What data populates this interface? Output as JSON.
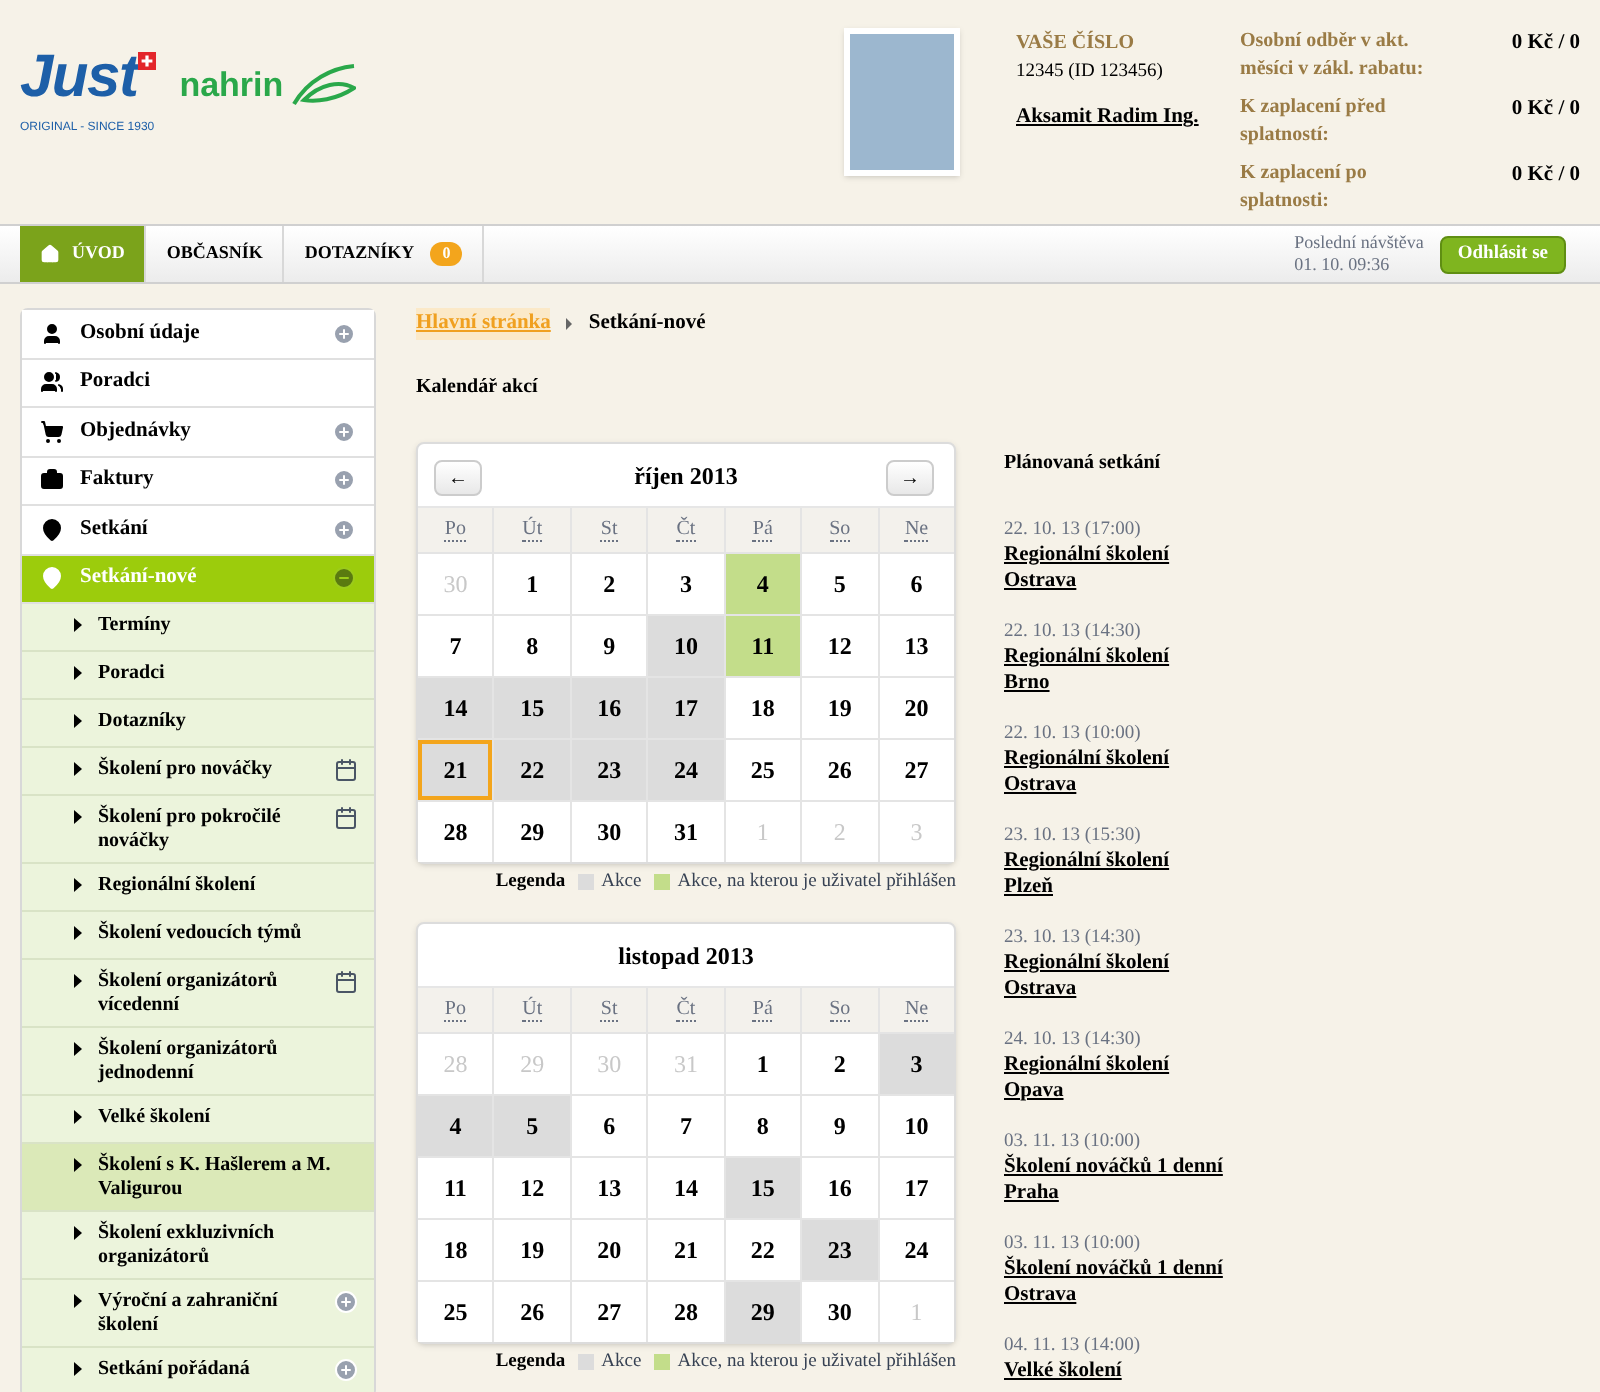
{
  "header": {
    "logo": {
      "brand": "Just",
      "tagline": "ORIGINAL - SINCE 1930",
      "partner": "nahrin"
    },
    "account": {
      "label": "VAŠE ČÍSLO",
      "number": "12345 (ID 123456)",
      "name": "Aksamit Radim Ing."
    },
    "balances": [
      {
        "label": "Osobní odběr v akt. měsíci v zákl. rabatu:",
        "value": "0 Kč / 0"
      },
      {
        "label": "K zaplacení před splatností:",
        "value": "0 Kč / 0"
      },
      {
        "label": "K zaplacení po splatnosti:",
        "value": "0 Kč / 0"
      }
    ]
  },
  "nav": {
    "tabs": [
      {
        "label": "ÚVOD",
        "selected": true
      },
      {
        "label": "OBČASNÍK",
        "selected": false
      },
      {
        "label": "DOTAZNÍKY",
        "selected": false,
        "badge": "0"
      }
    ],
    "last_visit_label": "Poslední návštěva",
    "last_visit": "01. 10. 09:36",
    "logout": "Odhlásit se"
  },
  "sidebar": {
    "items": [
      {
        "label": "Osobní údaje",
        "kind": "person",
        "collapsible": true,
        "expanded": false,
        "selected": false
      },
      {
        "label": "Poradci",
        "kind": "people",
        "collapsible": false,
        "selected": false
      },
      {
        "label": "Objednávky",
        "kind": "cart",
        "collapsible": true,
        "expanded": false,
        "selected": false
      },
      {
        "label": "Faktury",
        "kind": "briefcase",
        "collapsible": true,
        "expanded": false,
        "selected": false
      },
      {
        "label": "Setkání",
        "kind": "pin",
        "collapsible": true,
        "expanded": false,
        "selected": false
      },
      {
        "label": "Setkání-nové",
        "kind": "pin",
        "collapsible": true,
        "expanded": true,
        "selected": true,
        "children": [
          {
            "label": "Termíny",
            "calendar": false,
            "collapsible": false,
            "selected": false
          },
          {
            "label": "Poradci",
            "calendar": false,
            "collapsible": false,
            "selected": false
          },
          {
            "label": "Dotazníky",
            "calendar": false,
            "collapsible": false,
            "selected": false
          },
          {
            "label": "Školení pro nováčky",
            "calendar": true,
            "collapsible": false,
            "selected": false
          },
          {
            "label": "Školení pro pokročilé nováčky",
            "calendar": true,
            "collapsible": false,
            "selected": false
          },
          {
            "label": "Regionální školení",
            "calendar": false,
            "collapsible": false,
            "selected": false
          },
          {
            "label": "Školení vedoucích týmů",
            "calendar": false,
            "collapsible": false,
            "selected": false
          },
          {
            "label": "Školení organizátorů vícedenní",
            "calendar": true,
            "collapsible": false,
            "selected": false
          },
          {
            "label": "Školení organizátorů jednodenní",
            "calendar": false,
            "collapsible": false,
            "selected": false
          },
          {
            "label": "Velké školení",
            "calendar": false,
            "collapsible": false,
            "selected": false
          },
          {
            "label": "Školení s K. Hašlerem a M. Valigurou",
            "calendar": false,
            "collapsible": false,
            "selected": true
          },
          {
            "label": "Školení exkluzivních organizátorů",
            "calendar": false,
            "collapsible": false,
            "selected": false
          },
          {
            "label": "Výroční a zahraniční školení",
            "calendar": false,
            "collapsible": true,
            "expanded": false,
            "selected": false
          },
          {
            "label": "Setkání pořádaná",
            "calendar": false,
            "collapsible": true,
            "expanded": false,
            "selected": false
          }
        ]
      }
    ]
  },
  "breadcrumb": [
    {
      "label": "Hlavní stránka",
      "kind": "link"
    },
    {
      "label": "Setkání-nové",
      "kind": "current"
    }
  ],
  "calendar_title": "Kalendář akcí",
  "calendars": [
    {
      "title": "říjen 2013",
      "prev": "←",
      "next": "→",
      "weekdays": [
        "Po",
        "Út",
        "St",
        "Čt",
        "Pá",
        "So",
        "Ne"
      ],
      "weeks": [
        [
          {
            "day": "30",
            "kind": "outside"
          },
          {
            "day": "1",
            "kind": "plain"
          },
          {
            "day": "2",
            "kind": "plain"
          },
          {
            "day": "3",
            "kind": "plain"
          },
          {
            "day": "4",
            "kind": "joined"
          },
          {
            "day": "5",
            "kind": "plain"
          },
          {
            "day": "6",
            "kind": "plain"
          }
        ],
        [
          {
            "day": "7",
            "kind": "plain"
          },
          {
            "day": "8",
            "kind": "plain"
          },
          {
            "day": "9",
            "kind": "plain"
          },
          {
            "day": "10",
            "kind": "event"
          },
          {
            "day": "11",
            "kind": "joined"
          },
          {
            "day": "12",
            "kind": "plain"
          },
          {
            "day": "13",
            "kind": "plain"
          }
        ],
        [
          {
            "day": "14",
            "kind": "event"
          },
          {
            "day": "15",
            "kind": "event"
          },
          {
            "day": "16",
            "kind": "event"
          },
          {
            "day": "17",
            "kind": "event"
          },
          {
            "day": "18",
            "kind": "plain"
          },
          {
            "day": "19",
            "kind": "plain"
          },
          {
            "day": "20",
            "kind": "plain"
          }
        ],
        [
          {
            "day": "21",
            "kind": "event_today"
          },
          {
            "day": "22",
            "kind": "event"
          },
          {
            "day": "23",
            "kind": "event"
          },
          {
            "day": "24",
            "kind": "event"
          },
          {
            "day": "25",
            "kind": "plain"
          },
          {
            "day": "26",
            "kind": "plain"
          },
          {
            "day": "27",
            "kind": "plain"
          }
        ],
        [
          {
            "day": "28",
            "kind": "plain"
          },
          {
            "day": "29",
            "kind": "plain"
          },
          {
            "day": "30",
            "kind": "plain"
          },
          {
            "day": "31",
            "kind": "plain"
          },
          {
            "day": "1",
            "kind": "outside"
          },
          {
            "day": "2",
            "kind": "outside"
          },
          {
            "day": "3",
            "kind": "outside"
          }
        ]
      ],
      "legend_title": "Legenda",
      "legend": [
        {
          "label": "Akce",
          "color": "#dcdcdc"
        },
        {
          "label": "Akce, na kterou je uživatel přihlášen",
          "color": "#c3dd8a"
        }
      ]
    },
    {
      "title": "listopad 2013",
      "weekdays": [
        "Po",
        "Út",
        "St",
        "Čt",
        "Pá",
        "So",
        "Ne"
      ],
      "weeks": [
        [
          {
            "day": "28",
            "kind": "outside"
          },
          {
            "day": "29",
            "kind": "outside"
          },
          {
            "day": "30",
            "kind": "outside"
          },
          {
            "day": "31",
            "kind": "outside"
          },
          {
            "day": "1",
            "kind": "plain"
          },
          {
            "day": "2",
            "kind": "plain"
          },
          {
            "day": "3",
            "kind": "event"
          }
        ],
        [
          {
            "day": "4",
            "kind": "event"
          },
          {
            "day": "5",
            "kind": "event"
          },
          {
            "day": "6",
            "kind": "plain"
          },
          {
            "day": "7",
            "kind": "plain"
          },
          {
            "day": "8",
            "kind": "plain"
          },
          {
            "day": "9",
            "kind": "plain"
          },
          {
            "day": "10",
            "kind": "plain"
          }
        ],
        [
          {
            "day": "11",
            "kind": "plain"
          },
          {
            "day": "12",
            "kind": "plain"
          },
          {
            "day": "13",
            "kind": "plain"
          },
          {
            "day": "14",
            "kind": "plain"
          },
          {
            "day": "15",
            "kind": "event"
          },
          {
            "day": "16",
            "kind": "plain"
          },
          {
            "day": "17",
            "kind": "plain"
          }
        ],
        [
          {
            "day": "18",
            "kind": "plain"
          },
          {
            "day": "19",
            "kind": "plain"
          },
          {
            "day": "20",
            "kind": "plain"
          },
          {
            "day": "21",
            "kind": "plain"
          },
          {
            "day": "22",
            "kind": "plain"
          },
          {
            "day": "23",
            "kind": "event"
          },
          {
            "day": "24",
            "kind": "plain"
          }
        ],
        [
          {
            "day": "25",
            "kind": "plain"
          },
          {
            "day": "26",
            "kind": "plain"
          },
          {
            "day": "27",
            "kind": "plain"
          },
          {
            "day": "28",
            "kind": "plain"
          },
          {
            "day": "29",
            "kind": "event"
          },
          {
            "day": "30",
            "kind": "plain"
          },
          {
            "day": "1",
            "kind": "outside"
          }
        ]
      ],
      "legend_title": "Legenda",
      "legend": [
        {
          "label": "Akce",
          "color": "#dcdcdc"
        },
        {
          "label": "Akce, na kterou je uživatel přihlášen",
          "color": "#c3dd8a"
        }
      ]
    }
  ],
  "planned": {
    "title": "Plánovaná setkání",
    "items": [
      {
        "date": "22. 10. 13 (17:00)",
        "title_lines": [
          "Regionální školení",
          "Ostrava"
        ]
      },
      {
        "date": "22. 10. 13 (14:30)",
        "title_lines": [
          "Regionální školení",
          "Brno"
        ]
      },
      {
        "date": "22. 10. 13 (10:00)",
        "title_lines": [
          "Regionální školení",
          "Ostrava"
        ]
      },
      {
        "date": "23. 10. 13 (15:30)",
        "title_lines": [
          "Regionální školení",
          "Plzeň"
        ]
      },
      {
        "date": "23. 10. 13 (14:30)",
        "title_lines": [
          "Regionální školení",
          "Ostrava"
        ]
      },
      {
        "date": "24. 10. 13 (14:30)",
        "title_lines": [
          "Regionální školení",
          "Opava"
        ]
      },
      {
        "date": "03. 11. 13 (10:00)",
        "title_lines": [
          "Školení nováčků 1 denní",
          "Praha"
        ]
      },
      {
        "date": "03. 11. 13 (10:00)",
        "title_lines": [
          "Školení nováčků 1 denní",
          "Ostrava"
        ]
      },
      {
        "date": "04. 11. 13 (14:00)",
        "title_lines": [
          "Velké školení"
        ]
      }
    ]
  }
}
